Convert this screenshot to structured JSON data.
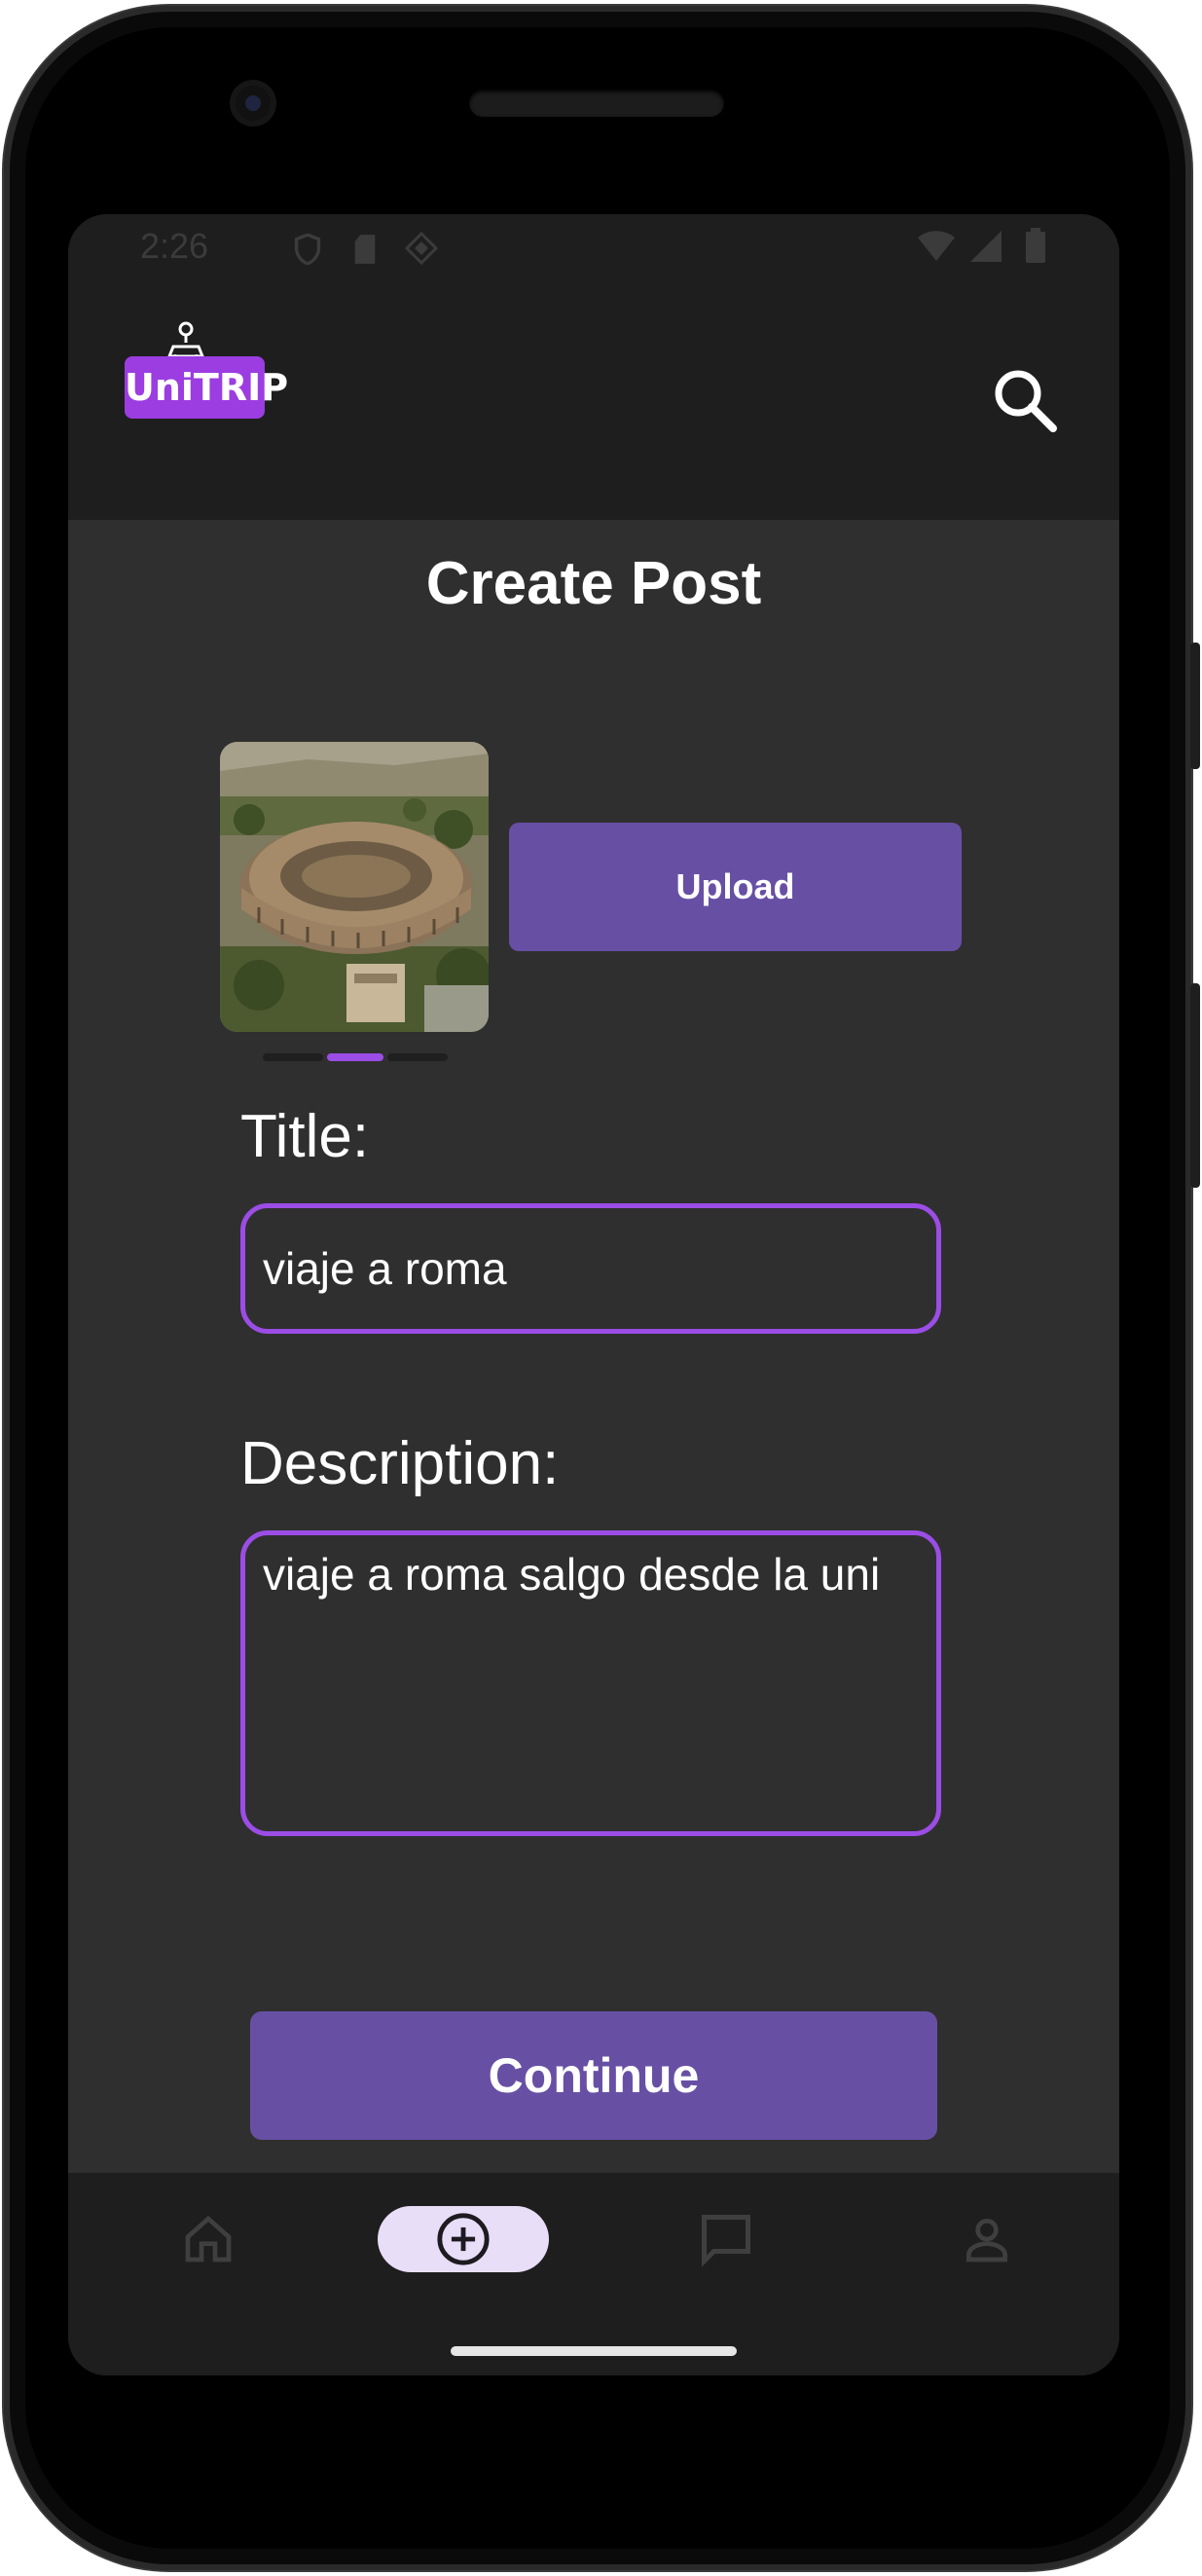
{
  "status_bar": {
    "time": "2:26",
    "left_icons": [
      "shield-icon",
      "sd-card-icon",
      "diamond-icon"
    ],
    "right_icons": [
      "wifi-icon",
      "signal-icon",
      "battery-icon"
    ]
  },
  "app_bar": {
    "logo_text": "UniTRIP",
    "brand_color": "#9b3de0",
    "search_icon": "search-icon"
  },
  "page": {
    "title": "Create Post"
  },
  "image_carousel": {
    "image_description": "aerial view of a colosseum",
    "current_index": 2,
    "total": 3
  },
  "upload": {
    "label": "Upload"
  },
  "form": {
    "title_label": "Title:",
    "title_value": "viaje a roma",
    "description_label": "Description:",
    "description_value": "viaje a roma salgo desde la uni",
    "accent_color": "#9b4de6"
  },
  "actions": {
    "continue_label": "Continue",
    "button_color": "#6750a4"
  },
  "bottom_nav": {
    "items": [
      {
        "icon": "home-icon",
        "active": false
      },
      {
        "icon": "add-circle-icon",
        "active": true
      },
      {
        "icon": "chat-icon",
        "active": false
      },
      {
        "icon": "person-icon",
        "active": false
      }
    ]
  }
}
